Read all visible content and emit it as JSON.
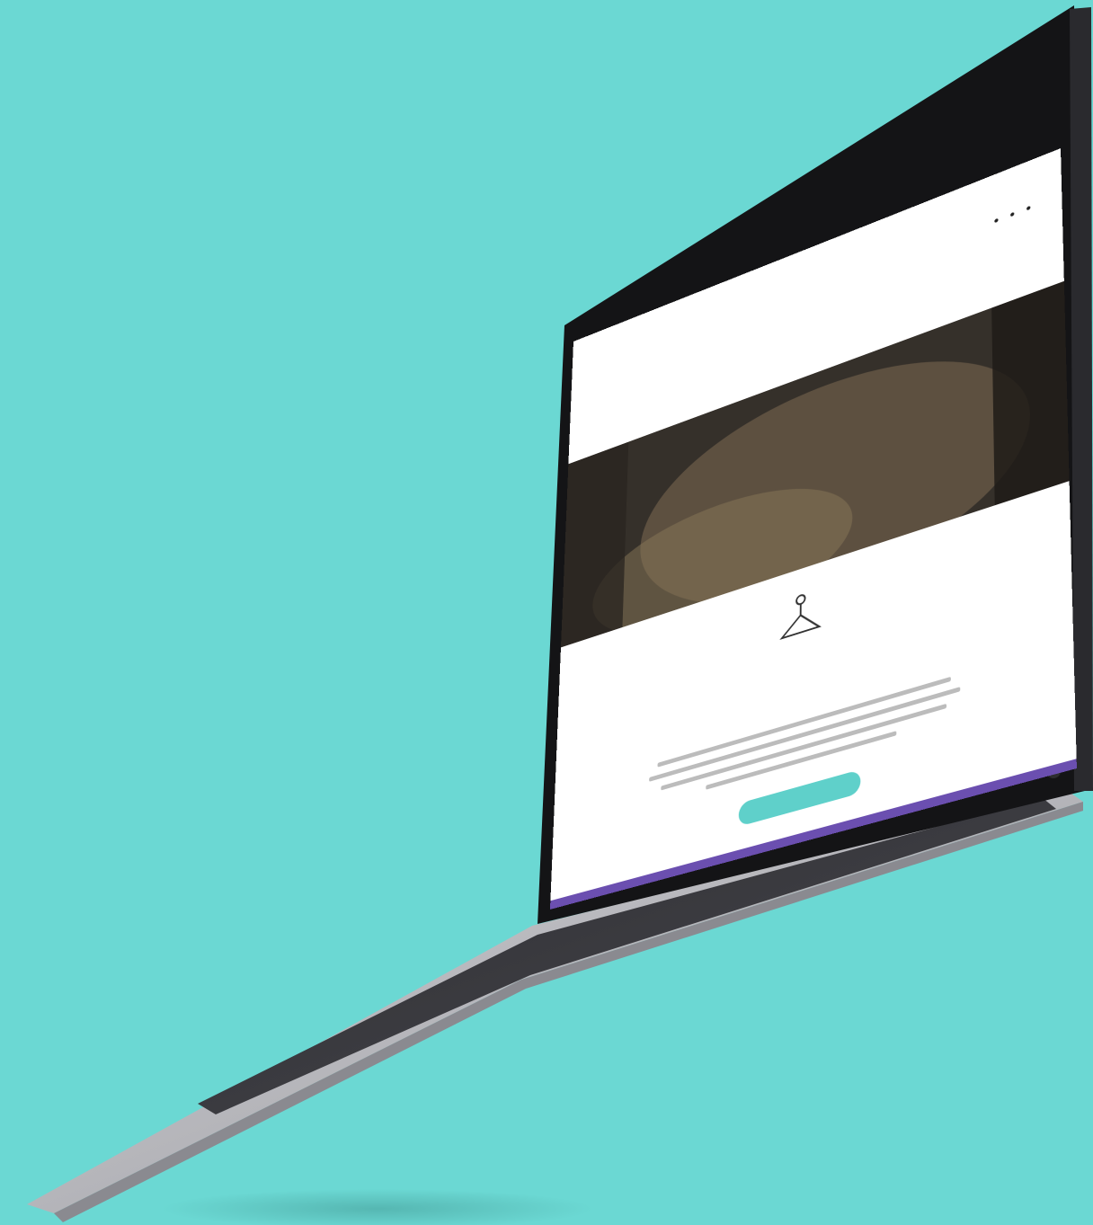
{
  "photo": {
    "background_color": "#6bd8d3",
    "laptop_body_color": "#1a1a1c",
    "keyboard_color": "#3c3c40",
    "palm_rest_color": "#b8b8bc"
  },
  "website": {
    "accent_color": "#5fd0ca",
    "footer_accent_color": "#6b4fb0",
    "hero_icon": "hanger-icon",
    "cta_button_label": ""
  }
}
